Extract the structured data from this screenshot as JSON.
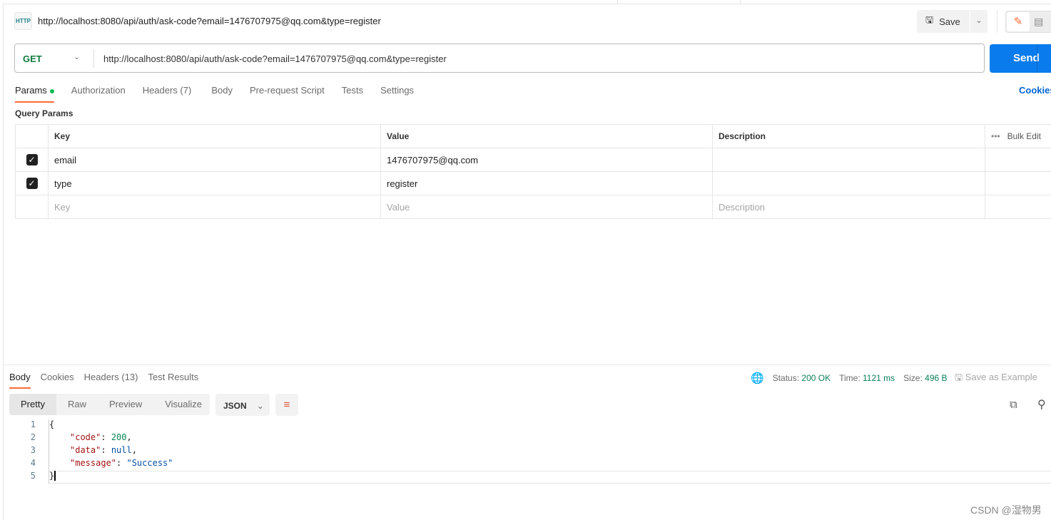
{
  "request": {
    "title": "http://localhost:8080/api/auth/ask-code?email=1476707975@qq.com&type=register",
    "method": "GET",
    "url": "http://localhost:8080/api/auth/ask-code?email=1476707975@qq.com&type=register",
    "http_icon": "HTTP",
    "save_label": "Save",
    "send_label": "Send"
  },
  "req_tabs": [
    "Params",
    "Authorization",
    "Headers (7)",
    "Body",
    "Pre-request Script",
    "Tests",
    "Settings"
  ],
  "cookies_label": "Cookies",
  "query_params": {
    "title": "Query Params",
    "headers": [
      "Key",
      "Value",
      "Description"
    ],
    "bulk_edit": "Bulk Edit",
    "rows": [
      {
        "key": "email",
        "value": "1476707975@qq.com",
        "checked": true
      },
      {
        "key": "type",
        "value": "register",
        "checked": true
      }
    ],
    "placeholders": {
      "key": "Key",
      "value": "Value",
      "description": "Description"
    }
  },
  "response": {
    "tabs": [
      "Body",
      "Cookies",
      "Headers (13)",
      "Test Results"
    ],
    "status_label": "Status:",
    "status": "200 OK",
    "time_label": "Time:",
    "time": "1121 ms",
    "size_label": "Size:",
    "size": "496 B",
    "save_example": "Save as Example",
    "views": [
      "Pretty",
      "Raw",
      "Preview",
      "Visualize"
    ],
    "format": "JSON",
    "lines": [
      "1",
      "2",
      "3",
      "4",
      "5"
    ],
    "code": {
      "open": "{",
      "k1": "\"code\"",
      "v1": "200",
      "k2": "\"data\"",
      "v2": "null",
      "k3": "\"message\"",
      "v3": "\"Success\"",
      "close": "}"
    }
  },
  "watermark": "CSDN @湿物男",
  "colors": {
    "accent": "#ff6c37",
    "send": "#097bed",
    "status_ok": "#0a7f5a"
  }
}
